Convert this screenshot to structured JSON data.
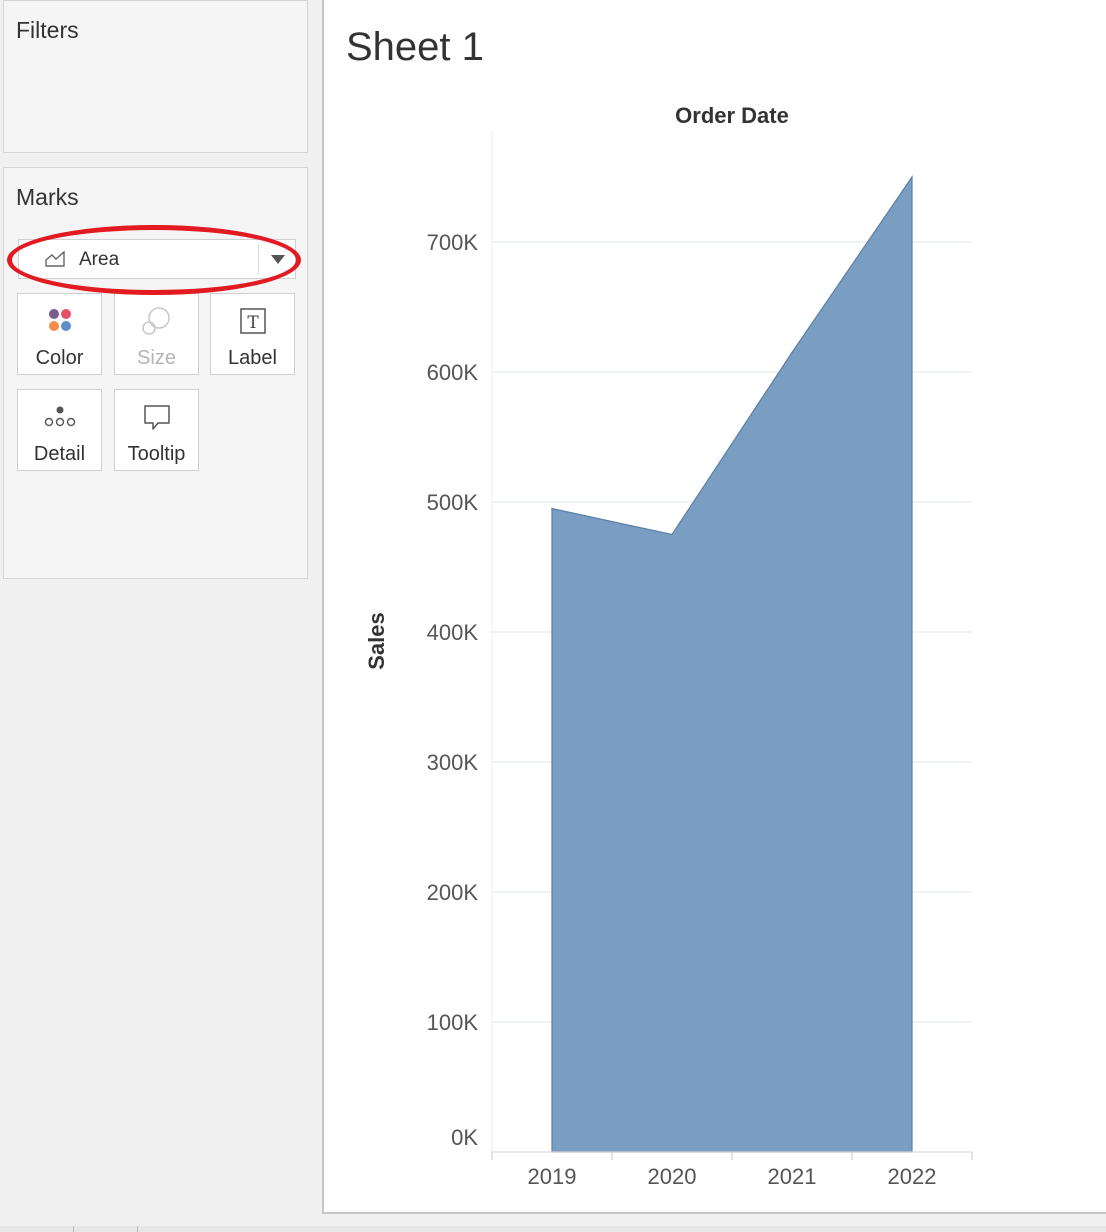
{
  "filters": {
    "title": "Filters"
  },
  "marks": {
    "title": "Marks",
    "mark_type": "Area",
    "buttons": {
      "color": "Color",
      "size": "Size",
      "label": "Label",
      "detail": "Detail",
      "tooltip": "Tooltip"
    }
  },
  "sheet": {
    "title": "Sheet 1"
  },
  "colors": {
    "area_fill": "#7a9ec2",
    "area_stroke": "#5b80a8",
    "annotation": "#e21a22"
  },
  "chart_data": {
    "type": "area",
    "title": "Order Date",
    "xlabel": "",
    "ylabel": "Sales",
    "categories": [
      "2019",
      "2020",
      "2021",
      "2022"
    ],
    "values": [
      495000,
      475000,
      615000,
      750000
    ],
    "ylim": [
      0,
      760000
    ],
    "yticks": [
      0,
      100000,
      200000,
      300000,
      400000,
      500000,
      600000,
      700000
    ],
    "ytick_labels": [
      "0K",
      "100K",
      "200K",
      "300K",
      "400K",
      "500K",
      "600K",
      "700K"
    ],
    "grid": true,
    "legend": "none"
  }
}
